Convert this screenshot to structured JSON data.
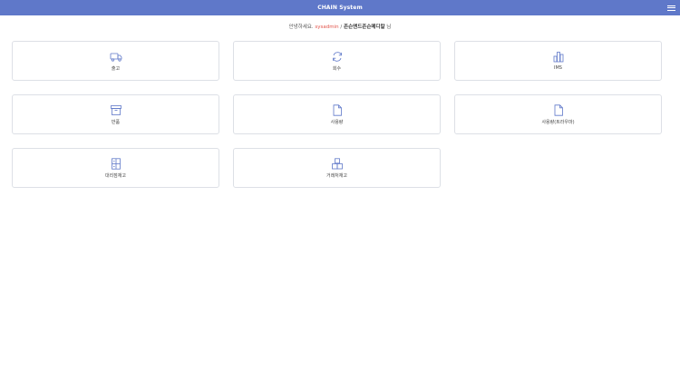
{
  "header": {
    "title": "CHAIN System",
    "menu_icon": "hamburger-menu-icon",
    "background_color": "#5f78c9"
  },
  "greeting": {
    "prefix": "안녕하세요. ",
    "username": "sysadmin",
    "separator": " / ",
    "organization": "존슨앤드존슨메디칼",
    "suffix": " 님",
    "username_color": "#e2534a"
  },
  "tiles": [
    {
      "label": "출고",
      "icon": "truck-icon"
    },
    {
      "label": "회수",
      "icon": "refresh-icon"
    },
    {
      "label": "IMS",
      "icon": "bar-chart-icon"
    },
    {
      "label": "반품",
      "icon": "archive-box-icon"
    },
    {
      "label": "사용량",
      "icon": "document-icon"
    },
    {
      "label": "사용량(트라우마)",
      "icon": "document-icon"
    },
    {
      "label": "대리점재고",
      "icon": "shelf-inventory-icon"
    },
    {
      "label": "거래처재고",
      "icon": "stacked-boxes-icon"
    }
  ],
  "icon_color": "#5f78c9"
}
